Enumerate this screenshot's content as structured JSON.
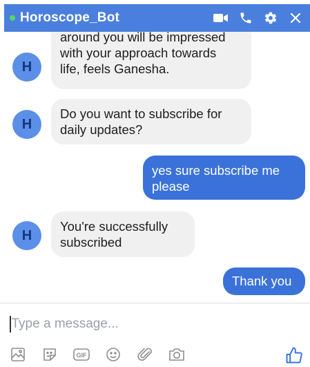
{
  "header": {
    "title": "Horoscope_Bot",
    "icons": [
      "video-call-icon",
      "phone-icon",
      "gear-icon",
      "close-icon"
    ],
    "accent": "#4a7fde",
    "online_color": "#53d769"
  },
  "messages": [
    {
      "from": "bot",
      "avatar": "H",
      "text_lines": [
        "around you will be impressed",
        "with your approach towards",
        "life, feels Ganesha."
      ]
    },
    {
      "from": "bot",
      "avatar": "H",
      "text_lines": [
        "Do you want to subscribe for",
        "daily updates?"
      ]
    },
    {
      "from": "user",
      "text_lines": [
        "yes sure subscribe me",
        "please"
      ]
    },
    {
      "from": "bot",
      "avatar": "H",
      "text_lines": [
        "You're successfully",
        "subscribed"
      ]
    },
    {
      "from": "user",
      "text_lines": [
        "Thank you"
      ]
    }
  ],
  "composer": {
    "placeholder": "Type a message...",
    "toolbar_icons": [
      "image-icon",
      "sticker-icon",
      "gif-icon",
      "emoji-icon",
      "attachment-icon",
      "camera-icon"
    ],
    "gif_label": "GIF",
    "like_icon": "thumbs-up-icon"
  },
  "colors": {
    "outgoing_bubble": "#3b72d9",
    "incoming_bubble": "#f1f0f0",
    "avatar_bg": "#5b8fe8"
  }
}
